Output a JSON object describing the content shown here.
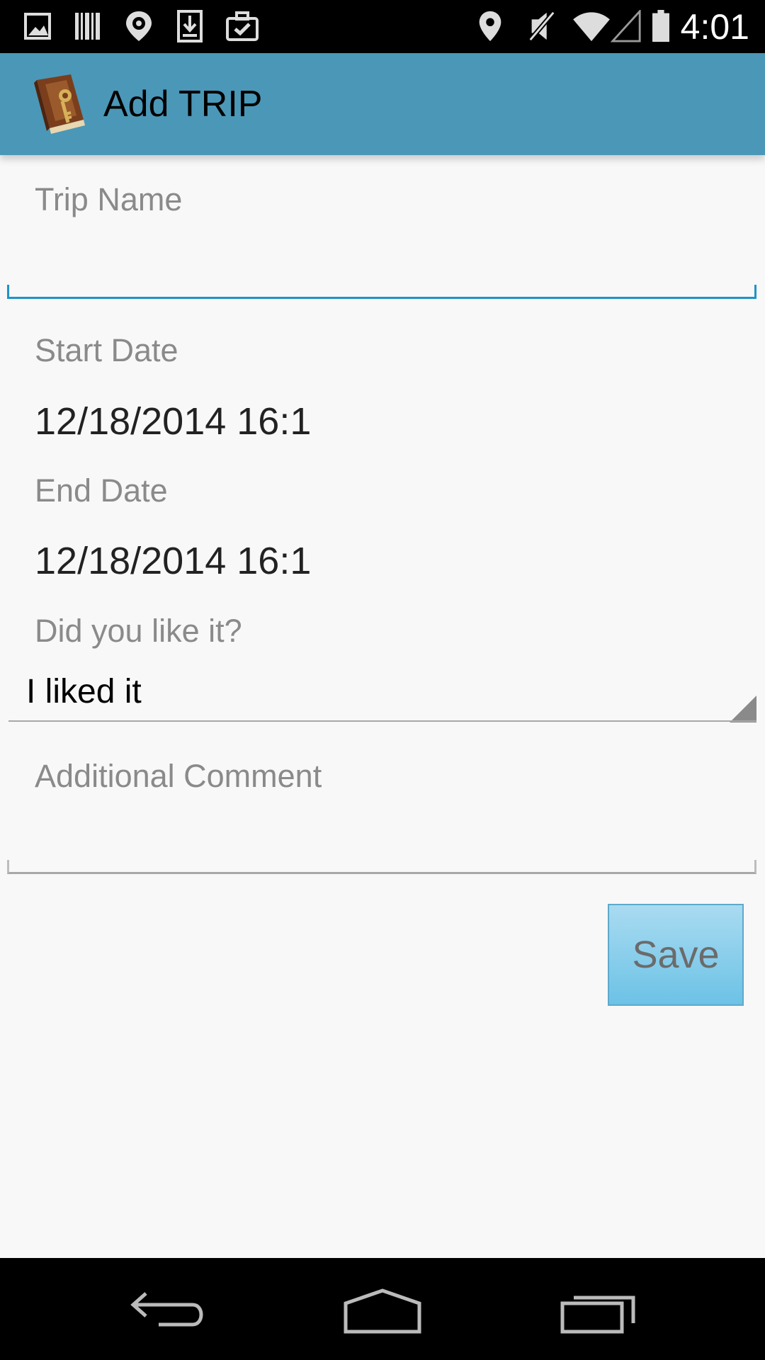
{
  "status_bar": {
    "time": "4:01",
    "left_icons": [
      "gallery-icon",
      "barcode-icon",
      "location-target-icon",
      "download-icon",
      "briefcase-check-icon"
    ],
    "right_icons": [
      "location-pin-icon",
      "mute-icon",
      "wifi-icon",
      "signal-icon",
      "battery-icon"
    ]
  },
  "action_bar": {
    "title": "Add TRIP",
    "icon": "book-key-icon",
    "color": "#4b97b7"
  },
  "form": {
    "trip_name": {
      "label": "Trip Name",
      "value": "",
      "accent": "#1e93c8"
    },
    "start_date": {
      "label": "Start Date",
      "value": "12/18/2014 16:1"
    },
    "end_date": {
      "label": "End Date",
      "value": "12/18/2014 16:1"
    },
    "rating": {
      "label": "Did you like it?",
      "selected": "I liked it"
    },
    "comment": {
      "label": "Additional Comment",
      "value": ""
    },
    "save_label": "Save"
  },
  "nav_bar": {
    "buttons": [
      "back-icon",
      "home-icon",
      "recent-apps-icon"
    ]
  }
}
